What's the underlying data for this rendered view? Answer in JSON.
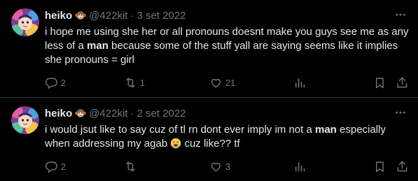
{
  "tweets": [
    {
      "name": "heiko",
      "handle": "@422kit",
      "separator": "·",
      "date": "3 set 2022",
      "text_parts": [
        "i hope me using she her or all pronouns doesnt make you guys see me as any less of a ",
        "man",
        " because some of the stuff yall are saying seems like it implies she pronouns = girl"
      ],
      "replies": "2",
      "retweets": "1",
      "likes": "21"
    },
    {
      "name": "heiko",
      "handle": "@422kit",
      "separator": "·",
      "date": "2 set 2022",
      "text_parts": [
        "i would jsut like to say cuz of tl rn dont ever imply im not a ",
        "man",
        " especially when addressing my agab ",
        " cuz like?? tf"
      ],
      "replies": "2",
      "retweets": "",
      "likes": "3"
    }
  ],
  "icons": {
    "more": "more-horizontal-icon",
    "reply": "reply-icon",
    "retweet": "retweet-icon",
    "like": "heart-icon",
    "views": "views-icon",
    "bookmark": "bookmark-icon",
    "share": "share-icon",
    "name_emoji": "monkey-face-emoji",
    "crying_emoji": "crying-face-emoji"
  },
  "colors": {
    "background": "#000000",
    "text": "#e7e9ea",
    "secondary": "#71767b",
    "divider": "#2f3336"
  }
}
